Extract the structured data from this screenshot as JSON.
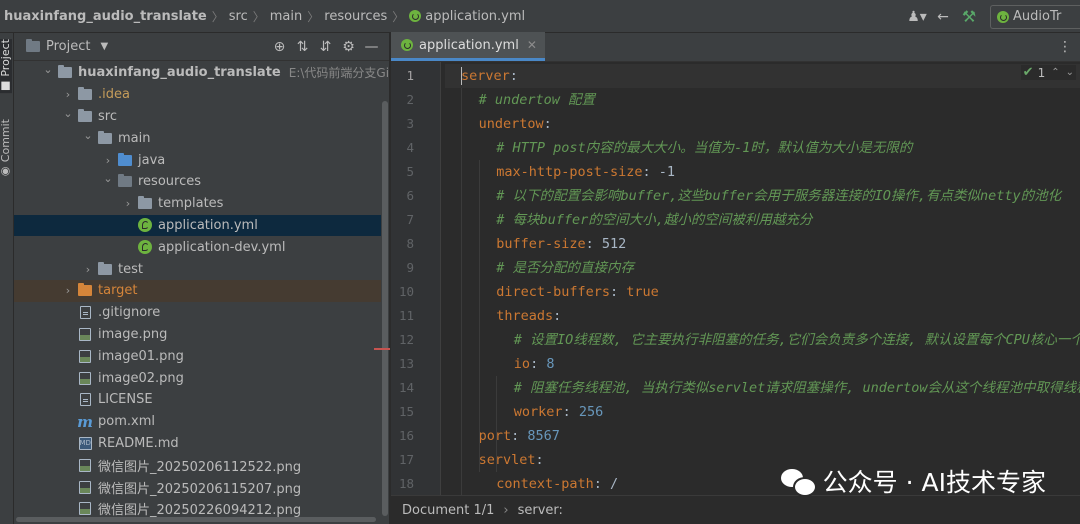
{
  "navbar": {
    "crumbs": [
      "huaxinfang_audio_translate",
      "src",
      "main",
      "resources",
      "application.yml"
    ],
    "run_config": "AudioTr"
  },
  "tool_strip": {
    "project_tab": "Project",
    "commit_tab": "Commit"
  },
  "project_panel": {
    "title": "Project",
    "tree": [
      {
        "label": "huaxinfang_audio_translate",
        "path": "E:\\代码前端分支Git\\hua",
        "depth": 0,
        "chevron": "open",
        "icon": "folder",
        "style": "bold"
      },
      {
        "label": ".idea",
        "depth": 1,
        "chevron": "closed",
        "icon": "folder",
        "style": "gold"
      },
      {
        "label": "src",
        "depth": 1,
        "chevron": "open",
        "icon": "folder",
        "style": "normal"
      },
      {
        "label": "main",
        "depth": 2,
        "chevron": "open",
        "icon": "folder",
        "style": "normal"
      },
      {
        "label": "java",
        "depth": 3,
        "chevron": "closed",
        "icon": "folder-blue",
        "style": "normal"
      },
      {
        "label": "resources",
        "depth": 3,
        "chevron": "open",
        "icon": "folder-res",
        "style": "normal"
      },
      {
        "label": "templates",
        "depth": 4,
        "chevron": "closed",
        "icon": "folder",
        "style": "normal"
      },
      {
        "label": "application.yml",
        "depth": 4,
        "chevron": "none",
        "icon": "yml",
        "style": "normal",
        "selected": true
      },
      {
        "label": "application-dev.yml",
        "depth": 4,
        "chevron": "none",
        "icon": "yml",
        "style": "normal"
      },
      {
        "label": "test",
        "depth": 2,
        "chevron": "closed",
        "icon": "folder",
        "style": "normal"
      },
      {
        "label": "target",
        "depth": 1,
        "chevron": "closed",
        "icon": "folder-orange",
        "style": "orange",
        "excluded": true
      },
      {
        "label": ".gitignore",
        "depth": 1,
        "chevron": "none",
        "icon": "file",
        "style": "normal"
      },
      {
        "label": "image.png",
        "depth": 1,
        "chevron": "none",
        "icon": "image",
        "style": "normal"
      },
      {
        "label": "image01.png",
        "depth": 1,
        "chevron": "none",
        "icon": "image",
        "style": "normal"
      },
      {
        "label": "image02.png",
        "depth": 1,
        "chevron": "none",
        "icon": "image",
        "style": "normal"
      },
      {
        "label": "LICENSE",
        "depth": 1,
        "chevron": "none",
        "icon": "file",
        "style": "normal"
      },
      {
        "label": "pom.xml",
        "depth": 1,
        "chevron": "none",
        "icon": "maven",
        "style": "normal"
      },
      {
        "label": "README.md",
        "depth": 1,
        "chevron": "none",
        "icon": "markdown",
        "style": "normal"
      },
      {
        "label": "微信图片_20250206112522.png",
        "depth": 1,
        "chevron": "none",
        "icon": "image",
        "style": "normal"
      },
      {
        "label": "微信图片_20250206115207.png",
        "depth": 1,
        "chevron": "none",
        "icon": "image",
        "style": "normal"
      },
      {
        "label": "微信图片_20250226094212.png",
        "depth": 1,
        "chevron": "none",
        "icon": "image",
        "style": "normal"
      }
    ]
  },
  "editor": {
    "tab_label": "application.yml",
    "inspection_count": "1",
    "lines": [
      {
        "num": "1",
        "indent": 0,
        "key": "server",
        "value": "",
        "vtype": "",
        "comment": "",
        "current": true
      },
      {
        "num": "2",
        "indent": 1,
        "key": "",
        "value": "",
        "vtype": "",
        "comment": "# undertow 配置"
      },
      {
        "num": "3",
        "indent": 1,
        "key": "undertow",
        "value": "",
        "vtype": "",
        "comment": ""
      },
      {
        "num": "4",
        "indent": 2,
        "key": "",
        "value": "",
        "vtype": "",
        "comment": "# HTTP post内容的最大大小。当值为-1时，默认值为大小是无限的"
      },
      {
        "num": "5",
        "indent": 2,
        "key": "max-http-post-size",
        "value": "-1",
        "vtype": "plain",
        "comment": ""
      },
      {
        "num": "6",
        "indent": 2,
        "key": "",
        "value": "",
        "vtype": "",
        "comment": "# 以下的配置会影响buffer,这些buffer会用于服务器连接的IO操作,有点类似netty的池化"
      },
      {
        "num": "7",
        "indent": 2,
        "key": "",
        "value": "",
        "vtype": "",
        "comment": "# 每块buffer的空间大小,越小的空间被利用越充分"
      },
      {
        "num": "8",
        "indent": 2,
        "key": "buffer-size",
        "value": "512",
        "vtype": "plain",
        "comment": ""
      },
      {
        "num": "9",
        "indent": 2,
        "key": "",
        "value": "",
        "vtype": "",
        "comment": "# 是否分配的直接内存"
      },
      {
        "num": "10",
        "indent": 2,
        "key": "direct-buffers",
        "value": "true",
        "vtype": "bool",
        "comment": ""
      },
      {
        "num": "11",
        "indent": 2,
        "key": "threads",
        "value": "",
        "vtype": "",
        "comment": ""
      },
      {
        "num": "12",
        "indent": 3,
        "key": "",
        "value": "",
        "vtype": "",
        "comment": "# 设置IO线程数, 它主要执行非阻塞的任务,它们会负责多个连接, 默认设置每个CPU核心一个线程"
      },
      {
        "num": "13",
        "indent": 3,
        "key": "io",
        "value": "8",
        "vtype": "num",
        "comment": ""
      },
      {
        "num": "14",
        "indent": 3,
        "key": "",
        "value": "",
        "vtype": "",
        "comment": "# 阻塞任务线程池, 当执行类似servlet请求阻塞操作, undertow会从这个线程池中取得线程"
      },
      {
        "num": "15",
        "indent": 3,
        "key": "worker",
        "value": "256",
        "vtype": "num",
        "comment": ""
      },
      {
        "num": "16",
        "indent": 1,
        "key": "port",
        "value": "8567",
        "vtype": "num",
        "comment": ""
      },
      {
        "num": "17",
        "indent": 1,
        "key": "servlet",
        "value": "",
        "vtype": "",
        "comment": ""
      },
      {
        "num": "18",
        "indent": 2,
        "key": "context-path",
        "value": "/",
        "vtype": "plain",
        "comment": ""
      }
    ]
  },
  "status": {
    "document": "Document 1/1",
    "path": "server:"
  },
  "watermark": {
    "text": "公众号 · AI技术专家"
  },
  "colors": {
    "yaml_key": "#cc7832",
    "comment": "#629755",
    "number": "#6897bb",
    "selection": "#0d293e",
    "accent": "#4a88c7"
  }
}
